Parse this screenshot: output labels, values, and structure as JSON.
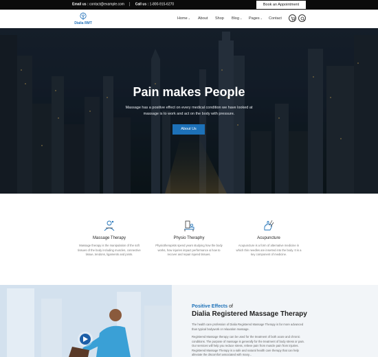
{
  "topbar": {
    "email_label": "Email us :",
    "email_value": "contact@example.com",
    "call_label": "Call us :",
    "call_value": "1-800-915-6270",
    "book_button": "Book an Appointment"
  },
  "navbar": {
    "logo_text": "Dialia RMT",
    "items": [
      {
        "label": "Home",
        "has_dropdown": true
      },
      {
        "label": "About",
        "has_dropdown": false
      },
      {
        "label": "Shop",
        "has_dropdown": false
      },
      {
        "label": "Blog",
        "has_dropdown": true
      },
      {
        "label": "Pages",
        "has_dropdown": true
      },
      {
        "label": "Contact",
        "has_dropdown": false
      }
    ],
    "icons": [
      "cart-icon",
      "search-icon"
    ]
  },
  "hero": {
    "title": "Pain makes People",
    "subtitle": "Massage has a positive effect on every medical condition we have looked at massage is to work and act on the body with pressure.",
    "button": "About Us"
  },
  "services": [
    {
      "icon": "massage-icon",
      "title": "Massage Therapy",
      "desc": "Massage therapy is the manipulation of the soft tissues of the body including muscles, connective tissue, tendons, ligaments and joints."
    },
    {
      "icon": "physio-icon",
      "title": "Physio Theraphy",
      "desc": "Physiotherapists spend years studying how the body works, how injuries impact performance & how to recover and repair injured tissues."
    },
    {
      "icon": "acupuncture-icon",
      "title": "Acupuncture",
      "desc": "Acupuncture is a form of alternative medicine in which thin needles are inserted into the body. It is a key component of medicine."
    }
  ],
  "about": {
    "kicker_highlight": "Positive Effects",
    "kicker_rest": "of",
    "heading": "Dialia Registered Massage Therapy",
    "p1": "The health care profession of Dialia Registered Massage Therapy is far more advanced than typical bodywork or relaxation massage.",
    "p2": "Registered Massage therapy can be used for the treatment of both acute and chronic conditions. The purpose of massage is generally for the treatment of body stress or pain. Our services will help you reduce stress, relieve pain from muscle pain from injuries. Registered Massage Therapy is a safe and natural health care therapy that can help alleviate the discomfort associated with many..."
  },
  "colors": {
    "accent": "#1d71b8",
    "topbar_bg": "#0b0b0b",
    "hero_bg": "#172130"
  }
}
